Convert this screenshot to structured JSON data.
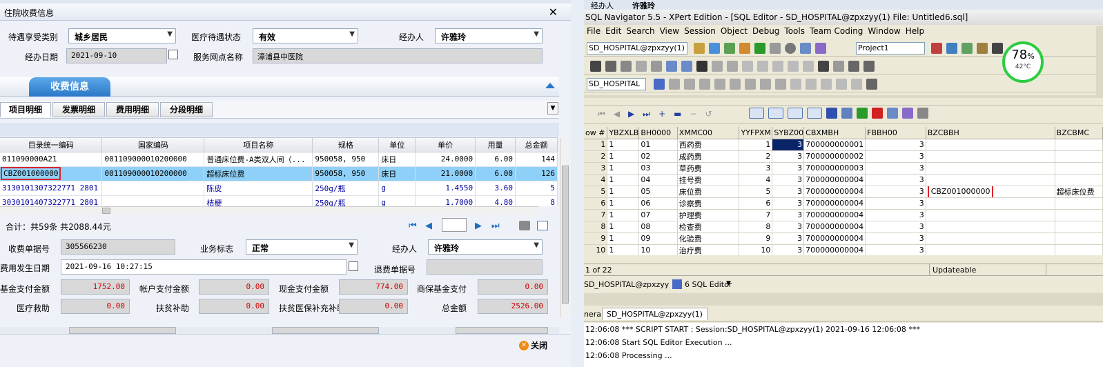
{
  "left": {
    "title": "住院收费信息",
    "close_glyph": "✕",
    "top_form": {
      "benefit_type_label": "待遇享受类别",
      "benefit_type_value": "城乡居民",
      "treatment_status_label": "医疗待遇状态",
      "treatment_status_value": "有效",
      "handler_label": "经办人",
      "handler_value": "许雅玲",
      "date_label": "经办日期",
      "date_value": "2021-09-10",
      "service_point_label": "服务网点名称",
      "service_point_value": "漳浦县中医院"
    },
    "section_title": "收费信息",
    "subtabs": [
      "项目明细",
      "发票明细",
      "费用明细",
      "分段明细"
    ],
    "grid": {
      "columns": [
        "目录统一编码",
        "国家编码",
        "项目名称",
        "规格",
        "单位",
        "单价",
        "用量",
        "总金额"
      ],
      "rows": [
        [
          "011090000A21",
          "001109000010200000",
          "普通床位费-A类双人间（...",
          "950058, 950",
          "床日",
          "24.0000",
          "6.00",
          "144"
        ],
        [
          "CBZ001000000",
          "001109000010200000",
          "超标床位费",
          "950058, 950",
          "床日",
          "21.0000",
          "6.00",
          "126"
        ],
        [
          "3130101307322771 2801",
          "",
          "陈皮",
          "250g/瓶",
          "g",
          "1.4550",
          "3.60",
          "5"
        ],
        [
          "3030101407322771 2801",
          "",
          "桔梗",
          "250g/瓶",
          "g",
          "1.7000",
          "4.80",
          "8"
        ]
      ]
    },
    "summary": "合计：共59条 共2088.44元",
    "bottom_form": {
      "bill_no_label": "收费单据号",
      "bill_no_value": "305566230",
      "business_flag_label": "业务标志",
      "business_flag_value": "正常",
      "handler_label": "经办人",
      "handler_value": "许雅玲",
      "occur_date_label": "费用发生日期",
      "occur_date_value": "2021-09-16 10:27:15",
      "refund_bill_label": "退费单据号",
      "refund_bill_value": "",
      "fund_pay_label": "基金支付金额",
      "fund_pay_value": "1752.00",
      "account_pay_label": "帐户支付金额",
      "account_pay_value": "0.00",
      "cash_pay_label": "现金支付金额",
      "cash_pay_value": "774.00",
      "commercial_pay_label": "商保基金支付",
      "commercial_pay_value": "0.00",
      "medical_aid_label": "医疗救助",
      "medical_aid_value": "0.00",
      "poverty_subsidy_label": "扶贫补助",
      "poverty_subsidy_value": "0.00",
      "poverty_insurance_label": "扶贫医保补充补助",
      "poverty_insurance_value": "0.00",
      "total_label": "总金额",
      "total_value": "2526.00"
    },
    "close_button": "关闭"
  },
  "right": {
    "top_tabs": [
      "经办人",
      "许雅玲"
    ],
    "title": "SQL Navigator 5.5 - XPert Edition - [SQL Editor - SD_HOSPITAL@zpxzyy(1) File: Untitled6.sql]",
    "menu": [
      "File",
      "Edit",
      "Search",
      "View",
      "Session",
      "Object",
      "Debug",
      "Tools",
      "Team Coding",
      "Window",
      "Help"
    ],
    "session_combo": "SD_HOSPITAL@zpxzyy(1)",
    "project_combo": "Project1",
    "schema_combo": "SD_HOSPITAL",
    "gauge_percent": "78",
    "gauge_percent_sign": "%",
    "gauge_temp": "42°C",
    "grid": {
      "columns": [
        "ow #",
        "YBZXLB",
        "BH0000",
        "XMMC00",
        "YYFPXM",
        "SYBZ00",
        "CBXMBH",
        "FBBH00",
        "BZCBBH",
        "BZCBMC"
      ],
      "rows": [
        [
          "1",
          "1",
          "01",
          "西药费",
          "1",
          "3",
          "700000000001",
          "3",
          "",
          ""
        ],
        [
          "2",
          "1",
          "02",
          "成药费",
          "2",
          "3",
          "700000000002",
          "3",
          "",
          ""
        ],
        [
          "3",
          "1",
          "03",
          "草药费",
          "3",
          "3",
          "700000000003",
          "3",
          "",
          ""
        ],
        [
          "4",
          "1",
          "04",
          "挂号费",
          "4",
          "3",
          "700000000004",
          "3",
          "",
          ""
        ],
        [
          "5",
          "1",
          "05",
          "床位费",
          "5",
          "3",
          "700000000004",
          "3",
          "CBZ001000000",
          "超标床位费"
        ],
        [
          "6",
          "1",
          "06",
          "诊察费",
          "6",
          "3",
          "700000000004",
          "3",
          "",
          ""
        ],
        [
          "7",
          "1",
          "07",
          "护理费",
          "7",
          "3",
          "700000000004",
          "3",
          "",
          ""
        ],
        [
          "8",
          "1",
          "08",
          "检查费",
          "8",
          "3",
          "700000000004",
          "3",
          "",
          ""
        ],
        [
          "9",
          "1",
          "09",
          "化验费",
          "9",
          "3",
          "700000000004",
          "3",
          "",
          ""
        ],
        [
          "10",
          "1",
          "10",
          "治疗费",
          "10",
          "3",
          "700000000004",
          "3",
          "",
          ""
        ]
      ]
    },
    "status_record": "1 of 22",
    "status_mode": "Updateable",
    "session_tab": "SD_HOSPITAL@zpxzyy",
    "editor_tab": "6 SQL Editor",
    "output_tabs": [
      "neral",
      "SD_HOSPITAL@zpxzyy(1)"
    ],
    "log": [
      "12:06:08  *** SCRIPT START :  Session:SD_HOSPITAL@zpxzyy(1)   2021-09-16 12:06:08 ***",
      "12:06:08  Start SQL Editor Execution ...",
      "12:06:08  Processing ..."
    ]
  }
}
